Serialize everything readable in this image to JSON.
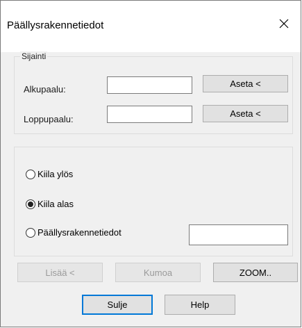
{
  "window": {
    "title": "Päällysrakennetiedot"
  },
  "location_group": {
    "legend": "Sijainti",
    "start_label": "Alkupaalu:",
    "start_value": "",
    "start_button": "Aseta <",
    "end_label": "Loppupaalu:",
    "end_value": "",
    "end_button": "Aseta <"
  },
  "options_group": {
    "options": [
      {
        "label": "Kiila ylös",
        "selected": false
      },
      {
        "label": "Kiila alas",
        "selected": true
      },
      {
        "label": "Päällysrakennetiedot",
        "selected": false
      }
    ],
    "extra_value": ""
  },
  "buttons": {
    "add": "Lisää <",
    "undo": "Kumoa",
    "zoom": "ZOOM..",
    "close": "Sulje",
    "help": "Help"
  },
  "icons": {
    "close": "close-icon",
    "radio_selected": "radio-selected",
    "radio_unselected": "radio-unselected"
  }
}
